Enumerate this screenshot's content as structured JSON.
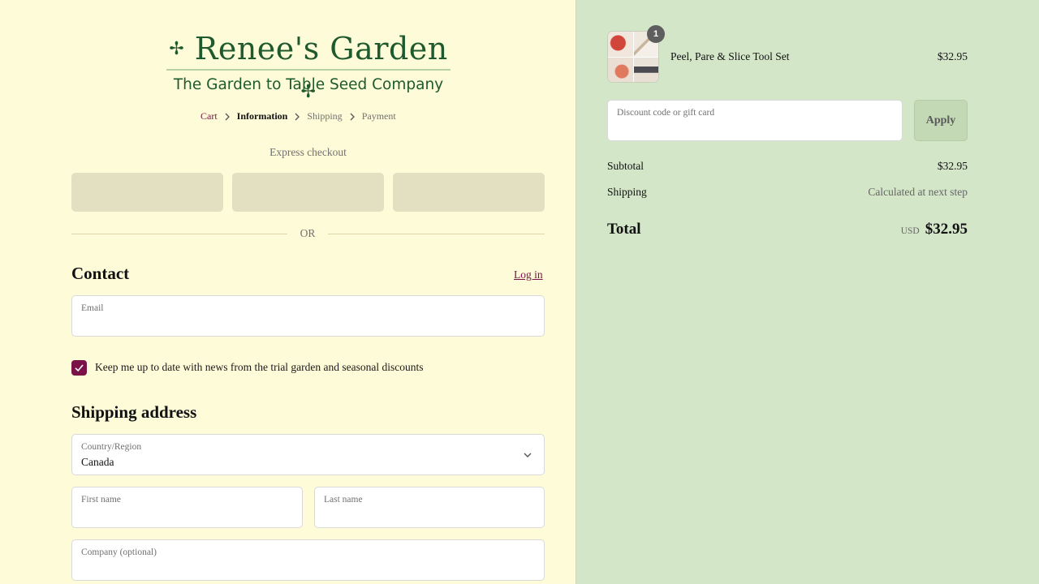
{
  "brand": {
    "name": "Renee's Garden",
    "tagline": "The Garden to Table Seed Company",
    "color": "#1f5a2e"
  },
  "breadcrumb": {
    "items": [
      {
        "label": "Cart",
        "state": "link"
      },
      {
        "label": "Information",
        "state": "current"
      },
      {
        "label": "Shipping",
        "state": "upcoming"
      },
      {
        "label": "Payment",
        "state": "upcoming"
      }
    ]
  },
  "express": {
    "label": "Express checkout",
    "divider": "OR"
  },
  "contact": {
    "heading": "Contact",
    "login_label": "Log in",
    "email_label": "Email",
    "email_value": "",
    "newsletter_label": "Keep me up to date with news from the trial garden and seasonal discounts",
    "newsletter_checked": true
  },
  "shipping": {
    "heading": "Shipping address",
    "country_label": "Country/Region",
    "country_value": "Canada",
    "first_name_label": "First name",
    "last_name_label": "Last name",
    "company_label": "Company (optional)"
  },
  "order": {
    "item": {
      "name": "Peel, Pare & Slice Tool Set",
      "price": "$32.95",
      "quantity": "1"
    },
    "discount_placeholder": "Discount code or gift card",
    "apply_label": "Apply",
    "subtotal_label": "Subtotal",
    "subtotal_value": "$32.95",
    "shipping_label": "Shipping",
    "shipping_value": "Calculated at next step",
    "total_label": "Total",
    "currency": "USD",
    "total_value": "$32.95"
  },
  "colors": {
    "left_bg": "#fefbd8",
    "right_bg": "#d3e6c8",
    "accent": "#7a1248"
  }
}
